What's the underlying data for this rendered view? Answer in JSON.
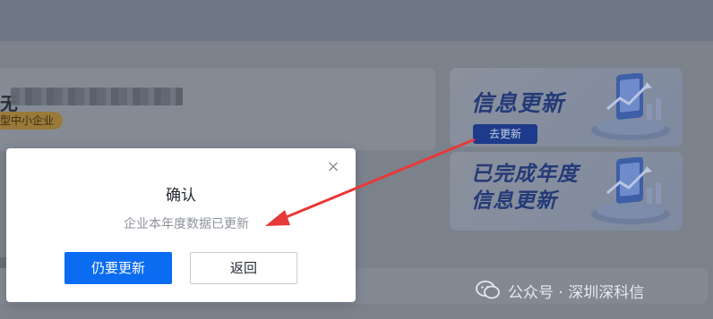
{
  "background": {
    "company_name_visible": "无",
    "company_tag": "型中小企业"
  },
  "banner1": {
    "title": "信息更新",
    "button_label": "去更新"
  },
  "banner2": {
    "title": "已完成年度\n信息更新"
  },
  "dialog": {
    "title": "确认",
    "message": "企业本年度数据已更新",
    "primary_button": "仍要更新",
    "secondary_button": "返回",
    "close_glyph": "×"
  },
  "watermark": {
    "text": "公众号 · 深圳深科信"
  },
  "colors": {
    "primary": "#0a6cf0",
    "arrow": "#e8393a",
    "banner_title": "#243a78"
  },
  "icons": {
    "close": "close-icon",
    "wechat": "wechat-icon",
    "illustration": "phone-chart-illustration"
  }
}
